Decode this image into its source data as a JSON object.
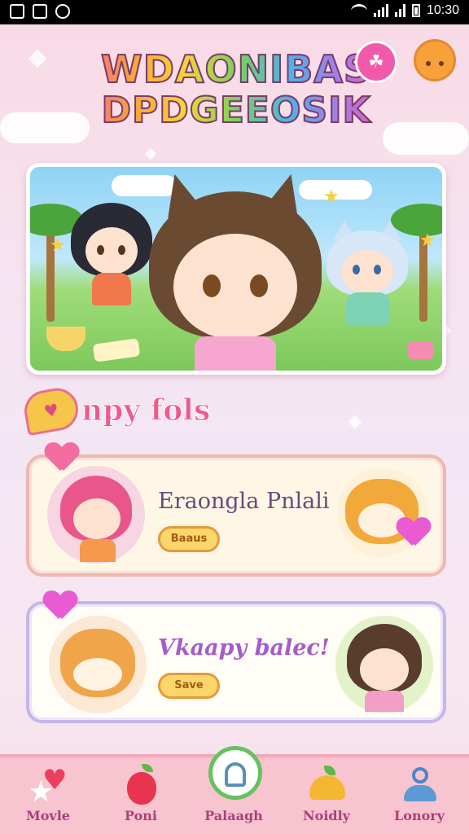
{
  "status_bar": {
    "time": "10:30"
  },
  "header": {
    "logo_line1": "WDAONIBAS",
    "logo_line2": "DPDGEEOSIK",
    "left_button_icon": "bunny-icon",
    "right_button_icon": "smiley-face-icon"
  },
  "section": {
    "badge_text": "♥",
    "title": "npy fols"
  },
  "cards": [
    {
      "title": "Eraongla Pnlali",
      "button_label": "Baaus"
    },
    {
      "title": "Vkaapy balec!",
      "button_label": "Save"
    }
  ],
  "bottom_nav": {
    "items": [
      {
        "label": "Movle",
        "icon": "heart-star-icon"
      },
      {
        "label": "Poni",
        "icon": "apple-icon"
      },
      {
        "label": "Palaagh",
        "icon": "home-bubble-icon",
        "active": true
      },
      {
        "label": "Noidly",
        "icon": "fruit-basket-icon"
      },
      {
        "label": "Lonory",
        "icon": "person-icon"
      }
    ]
  },
  "colors": {
    "accent_pink": "#ee5a8e",
    "nav_bg": "#f8c4cf",
    "active_ring": "#66c25f"
  }
}
